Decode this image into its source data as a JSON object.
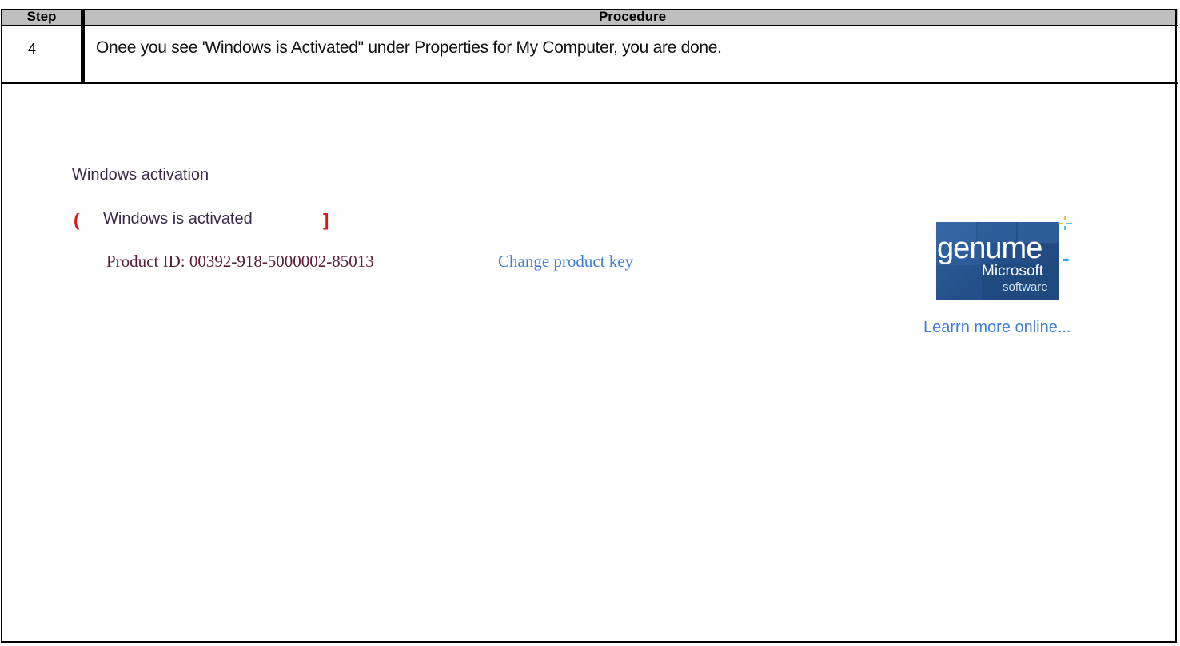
{
  "table": {
    "headers": {
      "step": "Step",
      "procedure": "Procedure"
    },
    "rows": [
      {
        "step": "4",
        "procedure": "Onee you see 'Windows is Activated\"  under Properties for My Computer, you are done."
      }
    ]
  },
  "activation": {
    "title": "Windows activation",
    "status": "Windows is activated",
    "bracket_left": "(",
    "bracket_right": "]",
    "product_id": "Product ID: 00392-918-5000002-85013",
    "change_key_link": "Change product key",
    "logo": {
      "word1": "genume",
      "word2": "Microsoft",
      "word3": "software",
      "dash": "-"
    },
    "learn_more_link": "Learrn more online..."
  },
  "colors": {
    "header_bg": "#bfbfbf",
    "link": "#3f7fd1",
    "bracket": "#e0141c",
    "text_purple": "#3a2a4a",
    "product_id_text": "#5a1e3a",
    "logo_blue": "#24508a"
  },
  "icons": {
    "logo": "genuine-microsoft-software-logo",
    "spark": "spark-icon"
  }
}
